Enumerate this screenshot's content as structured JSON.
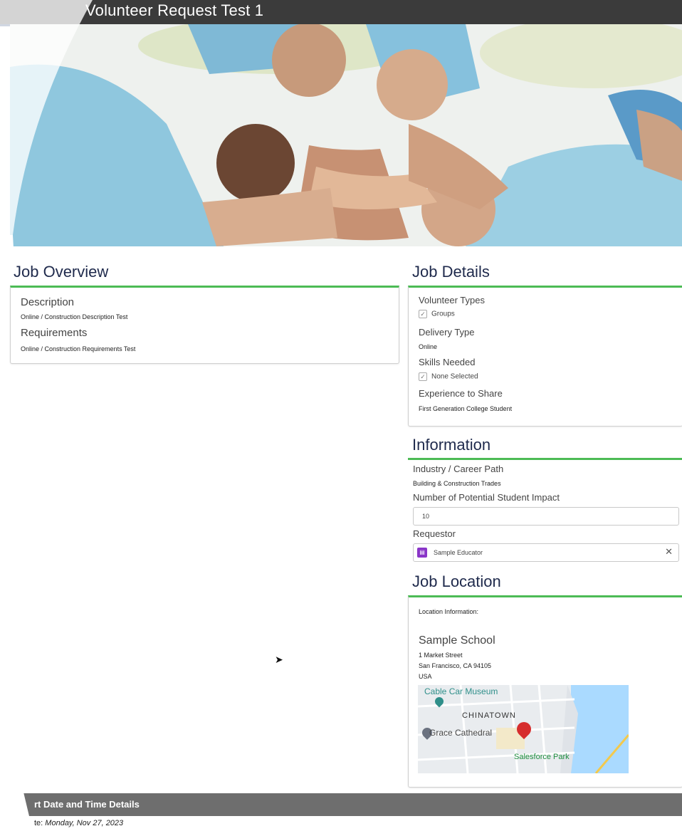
{
  "header": {
    "title": "Volunteer Request Test 1"
  },
  "overview": {
    "title": "Job Overview",
    "description_label": "Description",
    "description_value": "Online / Construction Description Test",
    "requirements_label": "Requirements",
    "requirements_value": "Online / Construction Requirements Test"
  },
  "details": {
    "title": "Job Details",
    "volunteer_types_label": "Volunteer Types",
    "volunteer_types_value": "Groups",
    "delivery_type_label": "Delivery Type",
    "delivery_type_value": "Online",
    "skills_label": "Skills Needed",
    "skills_value": "None Selected",
    "experience_label": "Experience to Share",
    "experience_value": "First Generation College Student"
  },
  "information": {
    "title": "Information",
    "industry_label": "Industry / Career Path",
    "industry_value": "Building & Construction Trades",
    "impact_label": "Number of Potential Student Impact",
    "impact_value": "10",
    "requestor_label": "Requestor",
    "requestor_value": "Sample Educator",
    "clear_glyph": "✕"
  },
  "location": {
    "title": "Job Location",
    "info_label": "Location Information:",
    "school": "Sample School",
    "street": "1 Market Street",
    "city": "San Francisco, CA 94105",
    "country": "USA",
    "map_labels": {
      "museum": "Cable Car Museum",
      "chinatown": "CHINATOWN",
      "cathedral": "Grace Cathedral",
      "park": "Salesforce Park"
    }
  },
  "footer": {
    "section_title": "rt Date and Time Details",
    "date_prefix": "te:",
    "date_value": "Monday, Nov 27, 2023"
  },
  "colors": {
    "accent_green": "#4cbb55",
    "title_navy": "#1f2a4c",
    "pin_red": "#d62d2d"
  }
}
